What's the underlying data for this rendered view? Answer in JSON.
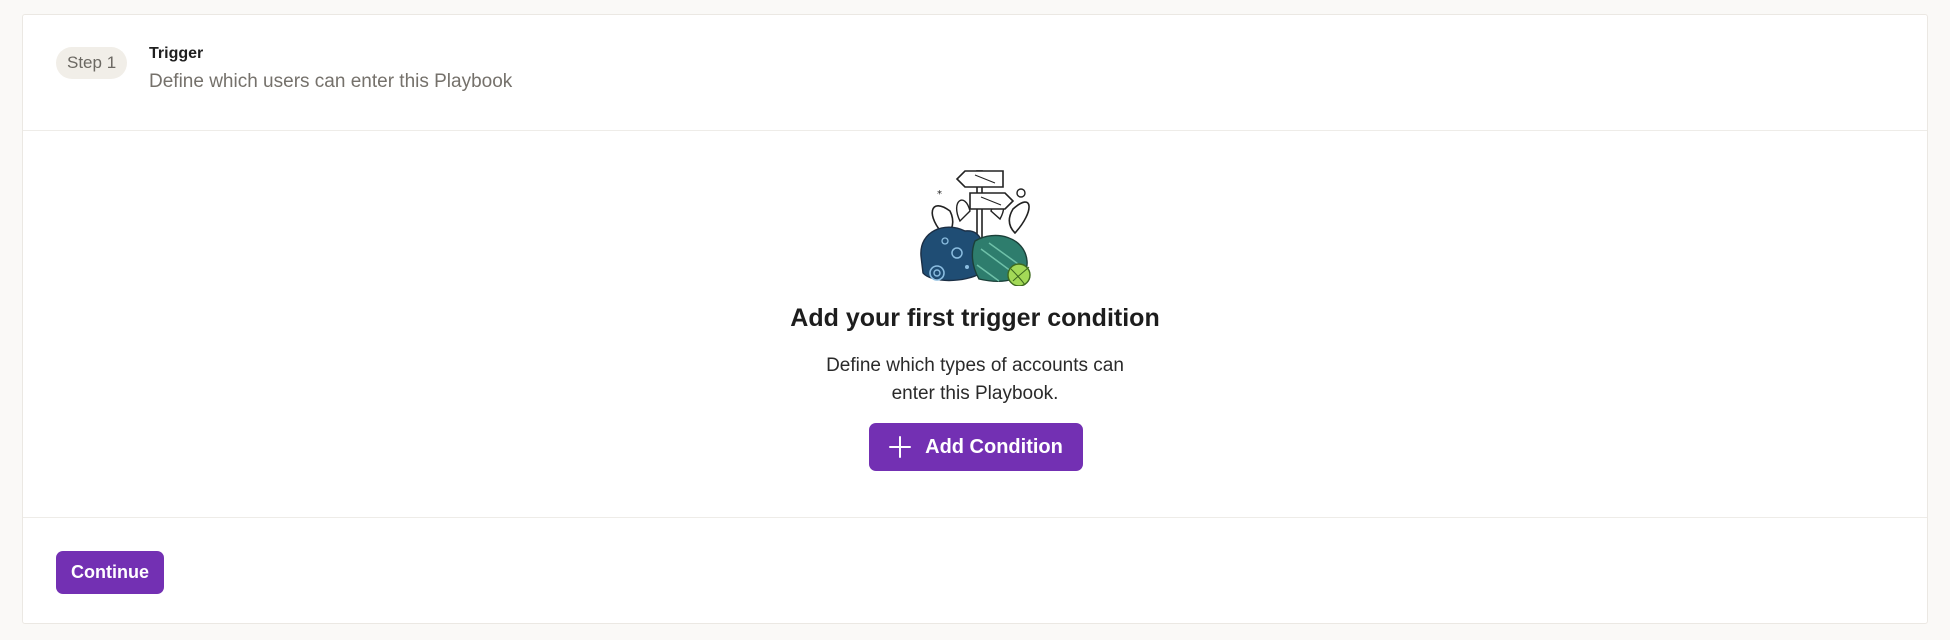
{
  "step": {
    "badge": "Step 1",
    "title": "Trigger",
    "description": "Define which users can enter this Playbook"
  },
  "empty_state": {
    "illustration": "signpost-plants-illustration",
    "title": "Add your first trigger condition",
    "description": "Define which types of accounts can enter this Playbook.",
    "button_label": "Add Condition",
    "button_icon": "plus-icon"
  },
  "footer": {
    "continue_label": "Continue"
  },
  "colors": {
    "accent": "#7330b3",
    "pill_bg": "#f1eee8",
    "page_bg": "#faf9f7"
  }
}
